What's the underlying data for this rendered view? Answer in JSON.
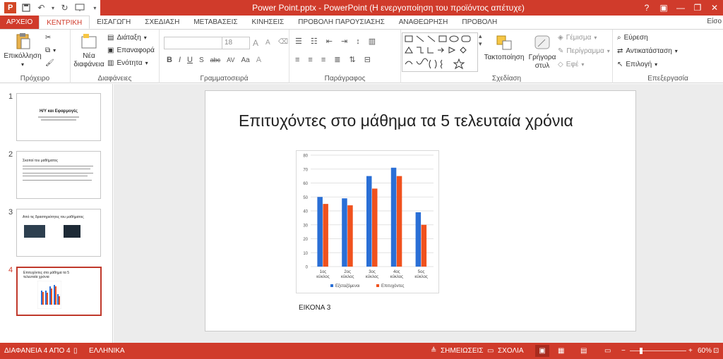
{
  "titlebar": {
    "title": "Power Point.pptx - PowerPoint (Η ενεργοποίηση του προϊόντος απέτυχε)",
    "help": "?",
    "minimize": "—",
    "restore": "❐",
    "close": "✕",
    "app_logo": "P"
  },
  "tabs": [
    {
      "label": "ΑΡΧΕΙΟ"
    },
    {
      "label": "ΚΕΝΤΡΙΚΗ"
    },
    {
      "label": "ΕΙΣΑΓΩΓΗ"
    },
    {
      "label": "ΣΧΕΔΙΑΣΗ"
    },
    {
      "label": "ΜΕΤΑΒΑΣΕΙΣ"
    },
    {
      "label": "ΚΙΝΗΣΕΙΣ"
    },
    {
      "label": "ΠΡΟΒΟΛΗ ΠΑΡΟΥΣΙΑΣΗΣ"
    },
    {
      "label": "ΑΝΑΘΕΩΡΗΣΗ"
    },
    {
      "label": "ΠΡΟΒΟΛΗ"
    }
  ],
  "user": "Είσο",
  "ribbon": {
    "clipboard": {
      "paste": "Επικόλληση",
      "label": "Πρόχειρο"
    },
    "slides": {
      "new_slide_1": "Νέα",
      "new_slide_2": "διαφάνεια",
      "layout": "Διάταξη",
      "reset": "Επαναφορά",
      "section": "Ενότητα",
      "label": "Διαφάνειες"
    },
    "font": {
      "size": "18",
      "label": "Γραμματοσειρά",
      "bold": "B",
      "italic": "I",
      "underline": "U",
      "strike": "S",
      "shadow": "abc",
      "spacing": "AV",
      "case": "Aa",
      "grow": "A",
      "shrink": "A"
    },
    "paragraph": {
      "label": "Παράγραφος"
    },
    "drawing": {
      "arrange_1": "Τακτοποίηση",
      "quick_styles_1": "Γρήγορα",
      "quick_styles_2": "στυλ",
      "fill": "Γέμισμα",
      "outline": "Περίγραμμα",
      "effects": "Εφέ",
      "label": "Σχεδίαση"
    },
    "editing": {
      "find": "Εύρεση",
      "replace": "Αντικατάσταση",
      "select": "Επιλογή",
      "label": "Επεξεργασία"
    }
  },
  "thumbnails": [
    {
      "num": "1",
      "title": "Η/Υ και Εφαρμογές",
      "sub": "Εισαγωγή"
    },
    {
      "num": "2",
      "title": "Σκοποί του μαθήματος"
    },
    {
      "num": "3",
      "title": "Από τις δραστηριότητες του μαθήματος"
    },
    {
      "num": "4",
      "title": "Επιτυχόντες στο μάθημα τα 5 τελευταία χρόνια"
    }
  ],
  "slide": {
    "title": "Επιτυχόντες στο μάθημα τα 5 τελευταία χρόνια",
    "caption": "ΕΙΚΟΝΑ 3"
  },
  "chart_data": {
    "type": "bar",
    "categories": [
      "1ος κύκλος",
      "2ος κύκλος",
      "3ος κύκλος",
      "4ος κύκλος",
      "5ος κύκλος"
    ],
    "category_lines": [
      [
        "1ος",
        "κύκλος"
      ],
      [
        "2ος",
        "κύκλος"
      ],
      [
        "3ος",
        "κύκλος"
      ],
      [
        "4ος",
        "κύκλος"
      ],
      [
        "5ος",
        "κύκλος"
      ]
    ],
    "series": [
      {
        "name": "Εξεταζόμενοι",
        "color": "#2a6fd6",
        "values": [
          50,
          49,
          65,
          71,
          39
        ]
      },
      {
        "name": "Επιτυχόντες",
        "color": "#f0521e",
        "values": [
          45,
          44,
          56,
          65,
          30
        ]
      }
    ],
    "ylim": [
      0,
      80
    ],
    "yticks": [
      0,
      10,
      20,
      30,
      40,
      50,
      60,
      70,
      80
    ],
    "grid": true,
    "legend": "bottom"
  },
  "statusbar": {
    "slide_info": "ΔΙΑΦΑΝΕΙΑ 4 ΑΠΟ 4",
    "language": "ΕΛΛΗΝΙΚΑ",
    "notes": "ΣΗΜΕΙΩΣΕΙΣ",
    "comments": "ΣΧΟΛΙΑ",
    "zoom": "60%"
  },
  "colors": {
    "accent": "#d03b2b"
  }
}
